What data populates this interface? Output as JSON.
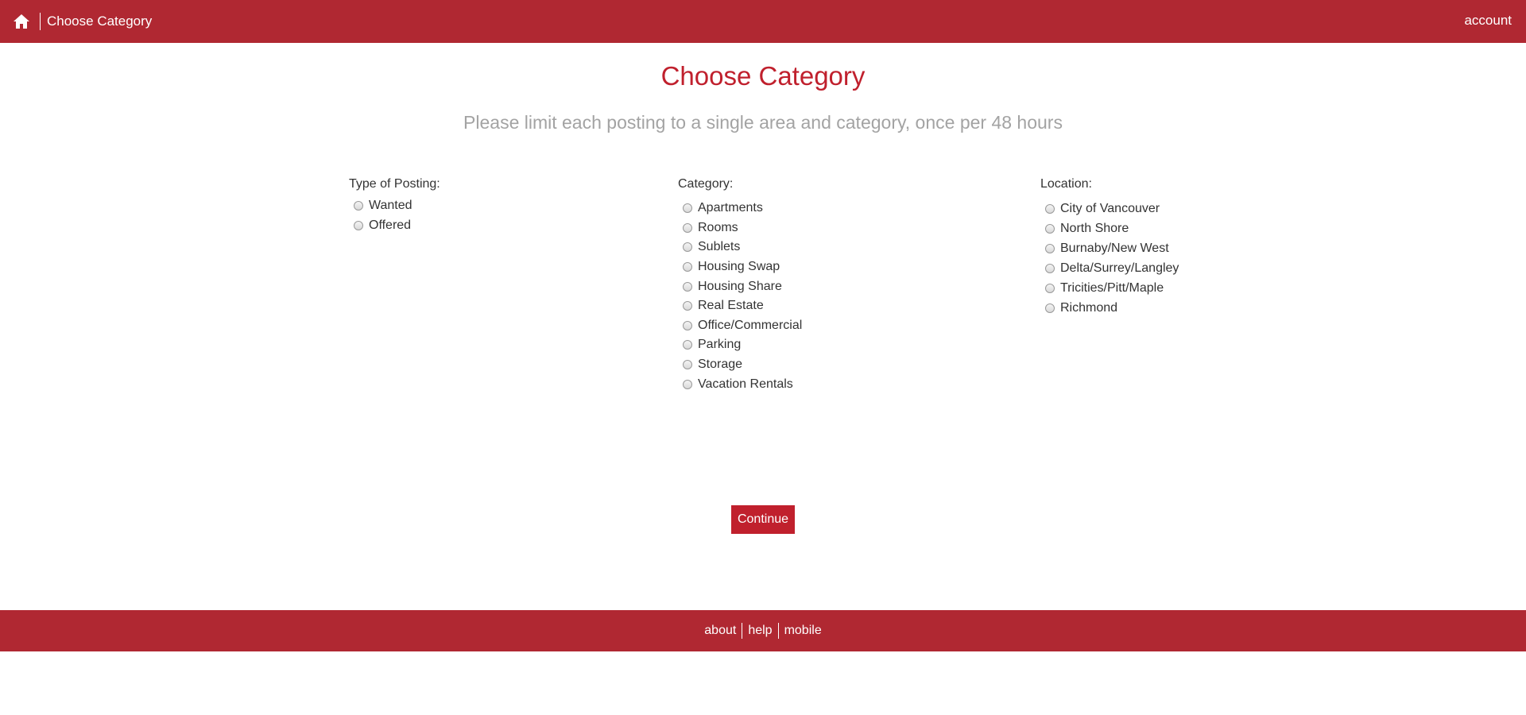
{
  "header": {
    "home_icon": "home-icon",
    "breadcrumb_title": "Choose Category",
    "account_label": "account"
  },
  "main": {
    "title": "Choose Category",
    "subtitle": "Please limit each posting to a single area and category, once per 48 hours",
    "type_of_posting": {
      "label": "Type of Posting:",
      "options": [
        "Wanted",
        "Offered"
      ]
    },
    "category": {
      "label": "Category:",
      "options": [
        "Apartments",
        "Rooms",
        "Sublets",
        "Housing Swap",
        "Housing Share",
        "Real Estate",
        "Office/Commercial",
        "Parking",
        "Storage",
        "Vacation Rentals"
      ]
    },
    "location": {
      "label": "Location:",
      "options": [
        "City of Vancouver",
        "North Shore",
        "Burnaby/New West",
        "Delta/Surrey/Langley",
        "Tricities/Pitt/Maple",
        "Richmond"
      ]
    },
    "continue_label": "Continue"
  },
  "footer": {
    "links": [
      "about",
      "help",
      "mobile"
    ]
  },
  "colors": {
    "brand_bar": "#b02832",
    "title_red": "#c0202d",
    "subtitle_gray": "#a3a3a3"
  }
}
